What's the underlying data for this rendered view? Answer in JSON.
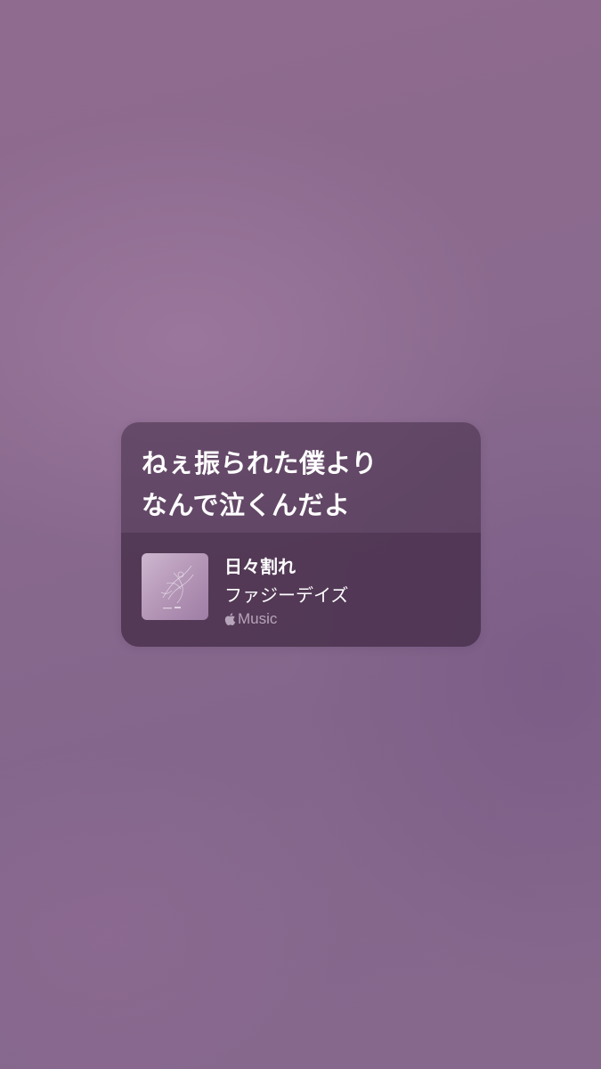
{
  "lyrics_card": {
    "lines": [
      "ねぇ振られた僕より",
      "なんで泣くんだよ"
    ],
    "song": {
      "title": "日々割れ",
      "artist": "ファジーデイズ"
    },
    "service": {
      "icon": "apple-logo-icon",
      "label": "Music"
    }
  },
  "colors": {
    "wallpaper": "#8a6a8e",
    "card_background": "#4a324e",
    "text": "#ffffff",
    "service_text": "#dccde0"
  }
}
